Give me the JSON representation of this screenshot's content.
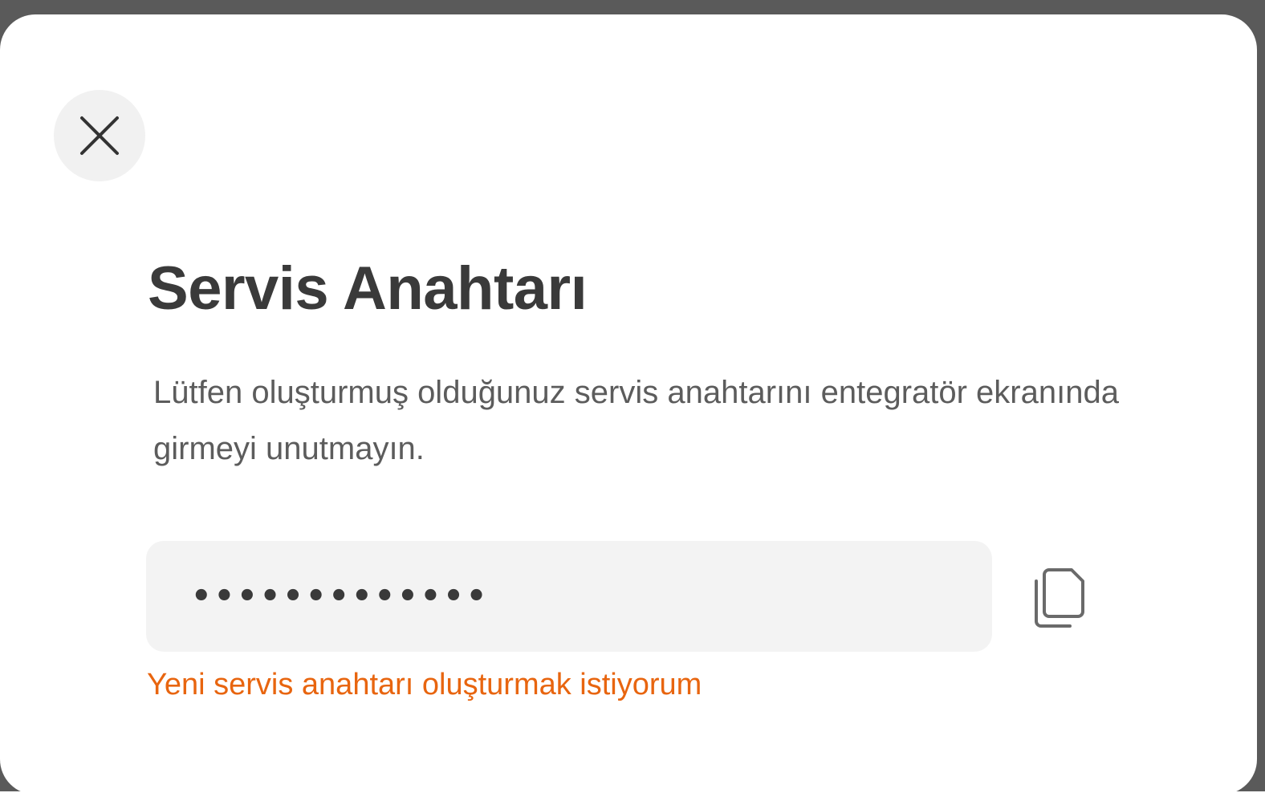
{
  "modal": {
    "title": "Servis Anahtarı",
    "description": "Lütfen oluşturmuş olduğunuz servis anahtarını entegratör ekranında girmeyi unutmayın.",
    "key_field": {
      "masked_value": "•••••••••••••"
    },
    "regenerate_link": "Yeni servis anahtarı oluşturmak istiyorum",
    "close_icon": "close-icon",
    "copy_icon": "copy-icon",
    "colors": {
      "accent": "#e8650f",
      "title": "#3a3a3a",
      "text": "#5c5c5c",
      "field_bg": "#f3f3f3",
      "close_bg": "#f1f1f1"
    }
  }
}
